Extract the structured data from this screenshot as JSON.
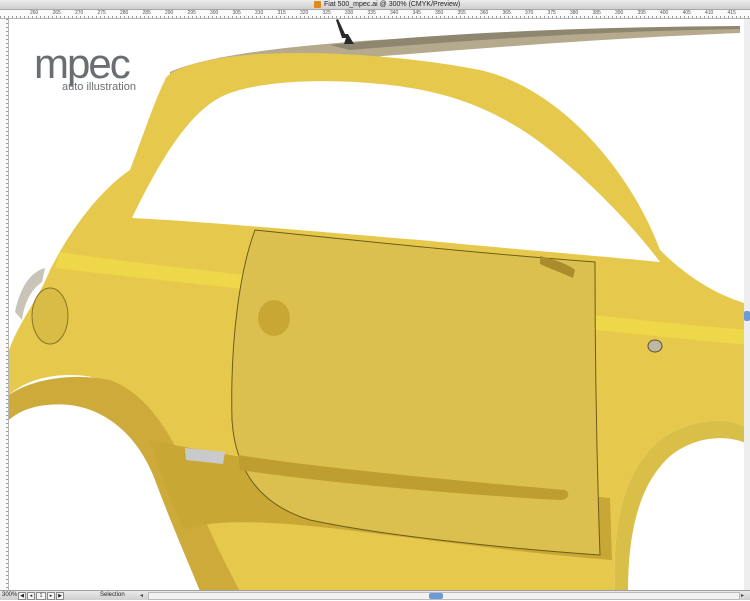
{
  "window": {
    "title": "Fiat 500_mpec.ai @ 300% (CMYK/Preview)"
  },
  "ruler": {
    "ticks": [
      "260",
      "265",
      "270",
      "275",
      "280",
      "285",
      "290",
      "295",
      "300",
      "305",
      "310",
      "315",
      "320",
      "325",
      "330",
      "335",
      "340",
      "345",
      "350",
      "355",
      "360",
      "365",
      "370",
      "375",
      "380",
      "385",
      "390",
      "395",
      "400",
      "405",
      "410",
      "415",
      "420"
    ]
  },
  "logo": {
    "main": "mpec",
    "sub": "auto illustration"
  },
  "status": {
    "zoom": "300%",
    "page": "1",
    "tool": "Selection"
  },
  "colors": {
    "body_base": "#E6C94C",
    "body_light": "#F0D84A",
    "body_shadow": "#C9A735",
    "roof": "#B5AA8E",
    "accent_scroll": "#6B9AD6"
  },
  "icons": [
    "file-icon",
    "first-page-icon",
    "prev-page-icon",
    "next-page-icon",
    "last-page-icon",
    "scroll-left-icon",
    "scroll-right-icon"
  ]
}
